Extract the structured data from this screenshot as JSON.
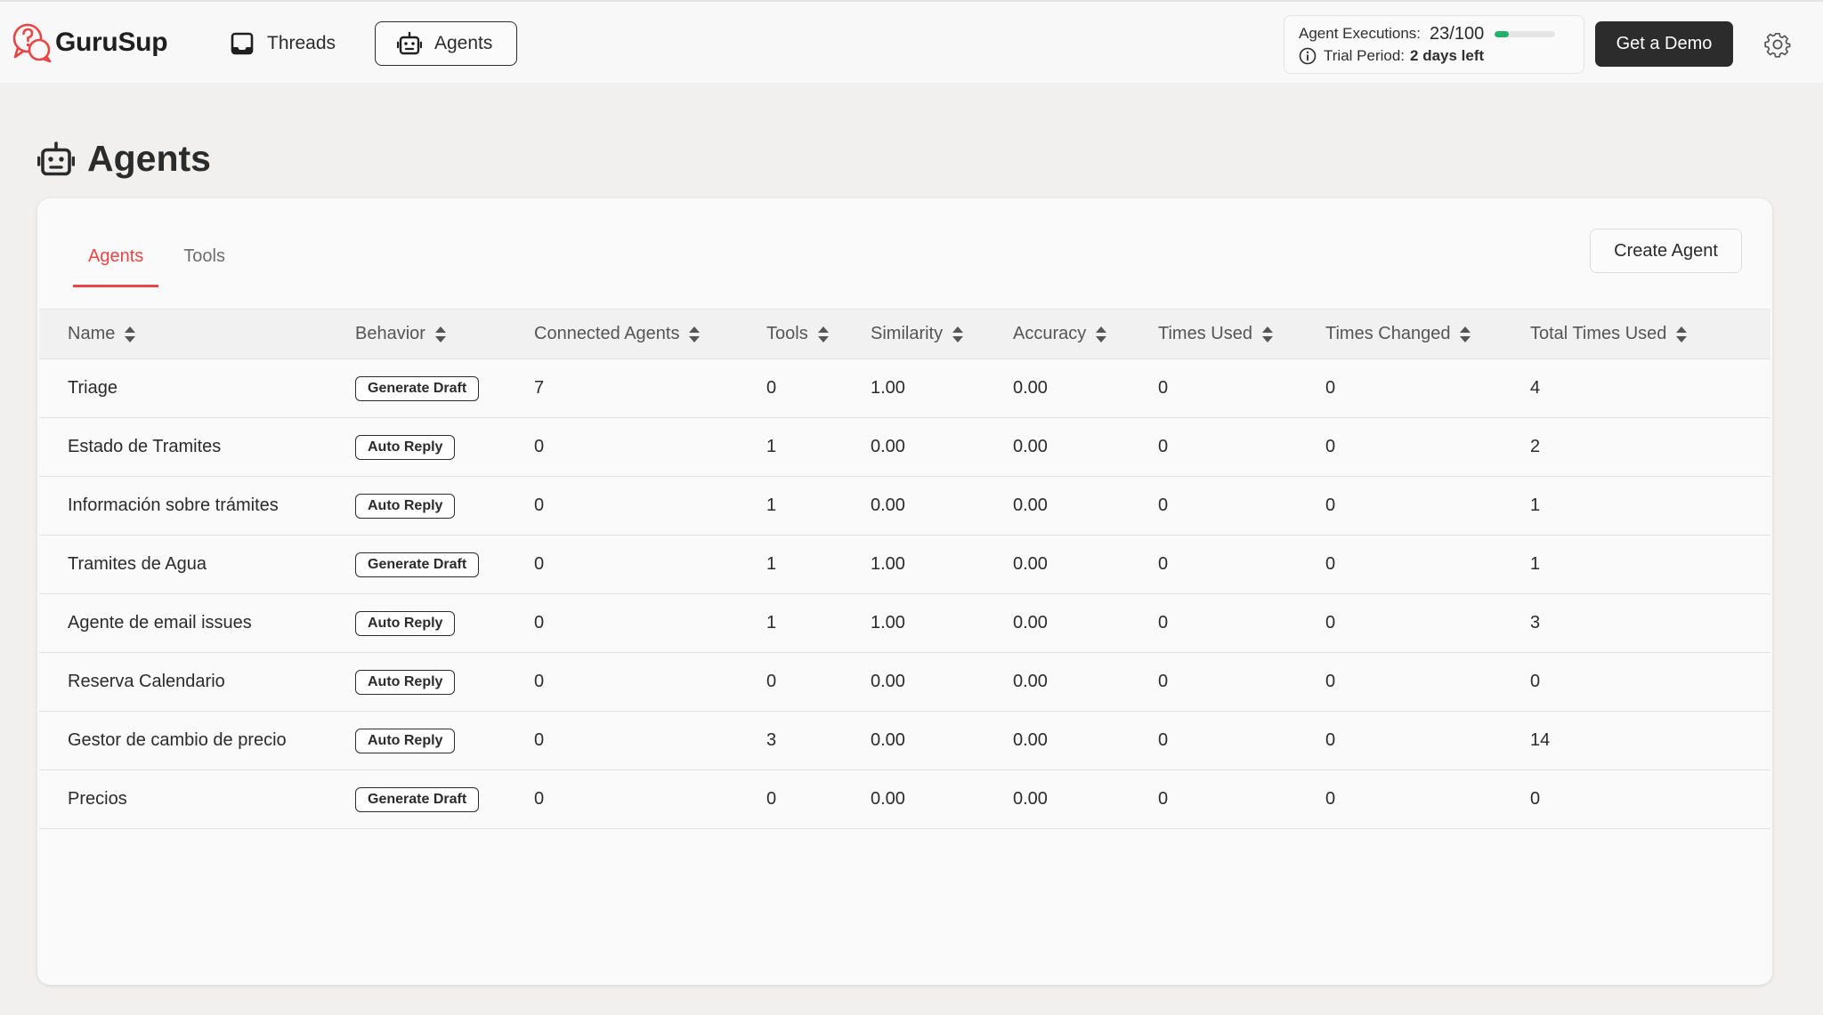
{
  "brand": {
    "name": "GuruSup",
    "accent": "#e94545"
  },
  "nav": {
    "threads_label": "Threads",
    "agents_label": "Agents"
  },
  "usage": {
    "executions_label": "Agent Executions:",
    "executions_used": "23",
    "executions_sep": "/",
    "executions_total": "100",
    "executions_progress": 0.23,
    "trial_label": "Trial Period:",
    "trial_value": "2 days left"
  },
  "header_actions": {
    "demo_label": "Get a Demo",
    "settings_icon": "gear-icon"
  },
  "page": {
    "title": "Agents",
    "icon": "robot-icon"
  },
  "tabs": [
    {
      "label": "Agents",
      "active": true
    },
    {
      "label": "Tools",
      "active": false
    }
  ],
  "create_label": "Create Agent",
  "table": {
    "columns": [
      "Name",
      "Behavior",
      "Connected Agents",
      "Tools",
      "Similarity",
      "Accuracy",
      "Times Used",
      "Times Changed",
      "Total Times Used"
    ],
    "rows": [
      {
        "name": "Triage",
        "behavior": "Generate Draft",
        "connected": "7",
        "tools": "0",
        "similarity": "1.00",
        "accuracy": "0.00",
        "times_used": "0",
        "times_changed": "0",
        "total": "4"
      },
      {
        "name": "Estado de Tramites",
        "behavior": "Auto Reply",
        "connected": "0",
        "tools": "1",
        "similarity": "0.00",
        "accuracy": "0.00",
        "times_used": "0",
        "times_changed": "0",
        "total": "2"
      },
      {
        "name": "Información sobre trámites",
        "behavior": "Auto Reply",
        "connected": "0",
        "tools": "1",
        "similarity": "0.00",
        "accuracy": "0.00",
        "times_used": "0",
        "times_changed": "0",
        "total": "1"
      },
      {
        "name": "Tramites de Agua",
        "behavior": "Generate Draft",
        "connected": "0",
        "tools": "1",
        "similarity": "1.00",
        "accuracy": "0.00",
        "times_used": "0",
        "times_changed": "0",
        "total": "1"
      },
      {
        "name": "Agente de email issues",
        "behavior": "Auto Reply",
        "connected": "0",
        "tools": "1",
        "similarity": "1.00",
        "accuracy": "0.00",
        "times_used": "0",
        "times_changed": "0",
        "total": "3"
      },
      {
        "name": "Reserva Calendario",
        "behavior": "Auto Reply",
        "connected": "0",
        "tools": "0",
        "similarity": "0.00",
        "accuracy": "0.00",
        "times_used": "0",
        "times_changed": "0",
        "total": "0"
      },
      {
        "name": "Gestor de cambio de precio",
        "behavior": "Auto Reply",
        "connected": "0",
        "tools": "3",
        "similarity": "0.00",
        "accuracy": "0.00",
        "times_used": "0",
        "times_changed": "0",
        "total": "14"
      },
      {
        "name": "Precios",
        "behavior": "Generate Draft",
        "connected": "0",
        "tools": "0",
        "similarity": "0.00",
        "accuracy": "0.00",
        "times_used": "0",
        "times_changed": "0",
        "total": "0"
      }
    ]
  }
}
